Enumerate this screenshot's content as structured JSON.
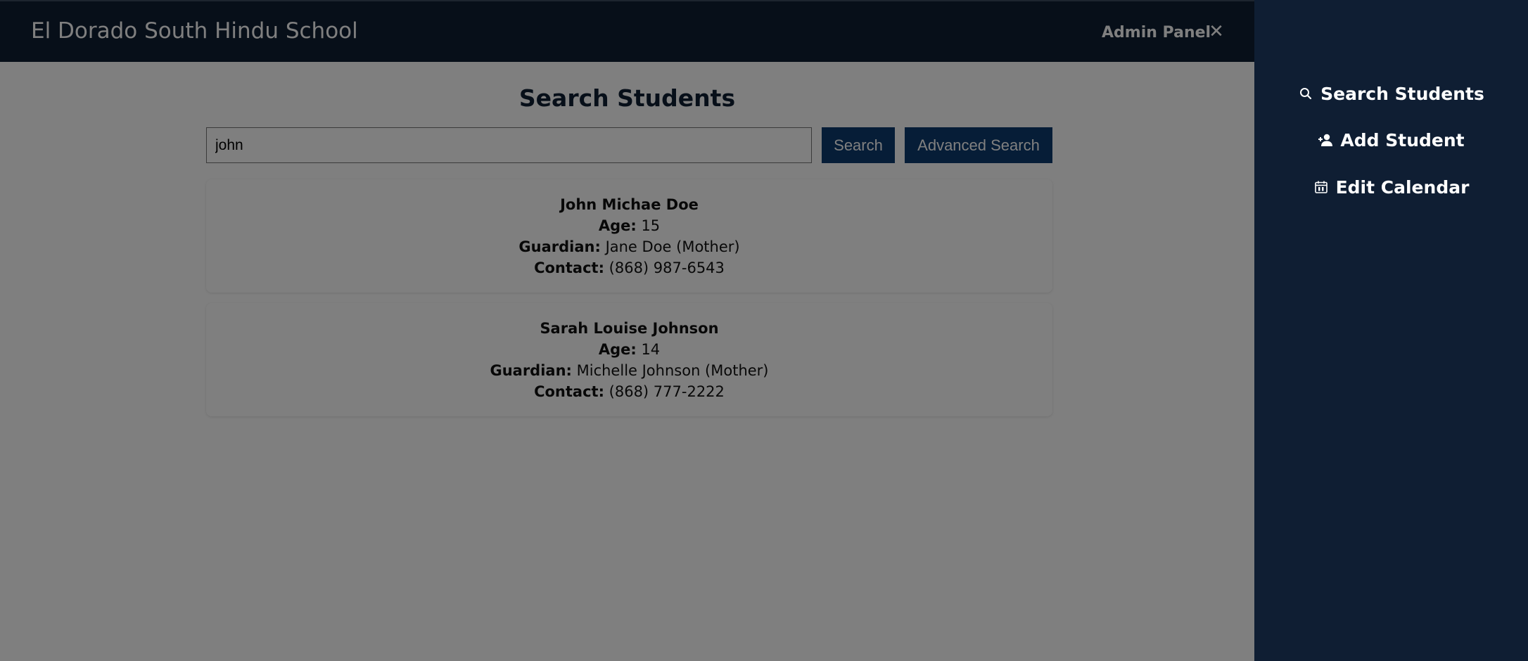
{
  "header": {
    "title": "El Dorado South Hindu School",
    "admin_label": "Admin Panel",
    "close_symbol": "✕"
  },
  "main": {
    "title": "Search Students",
    "search": {
      "value": "john",
      "search_button": "Search",
      "advanced_button": "Advanced Search"
    },
    "field_labels": {
      "age": "Age:",
      "guardian": "Guardian:",
      "contact": "Contact:"
    },
    "results": [
      {
        "name": "John Michae Doe",
        "age": "15",
        "guardian": "Jane Doe (Mother)",
        "contact": "(868) 987-6543"
      },
      {
        "name": "Sarah Louise Johnson",
        "age": "14",
        "guardian": "Michelle Johnson (Mother)",
        "contact": "(868) 777-2222"
      }
    ]
  },
  "sidebar": {
    "items": [
      {
        "label": "Search Students",
        "icon": "search-icon"
      },
      {
        "label": "Add Student",
        "icon": "add-user-icon"
      },
      {
        "label": "Edit Calendar",
        "icon": "calendar-icon"
      }
    ]
  },
  "colors": {
    "navy": "#0f1e33",
    "button_blue": "#0d3b6e",
    "overlay": "rgba(0,0,0,0.5)"
  }
}
